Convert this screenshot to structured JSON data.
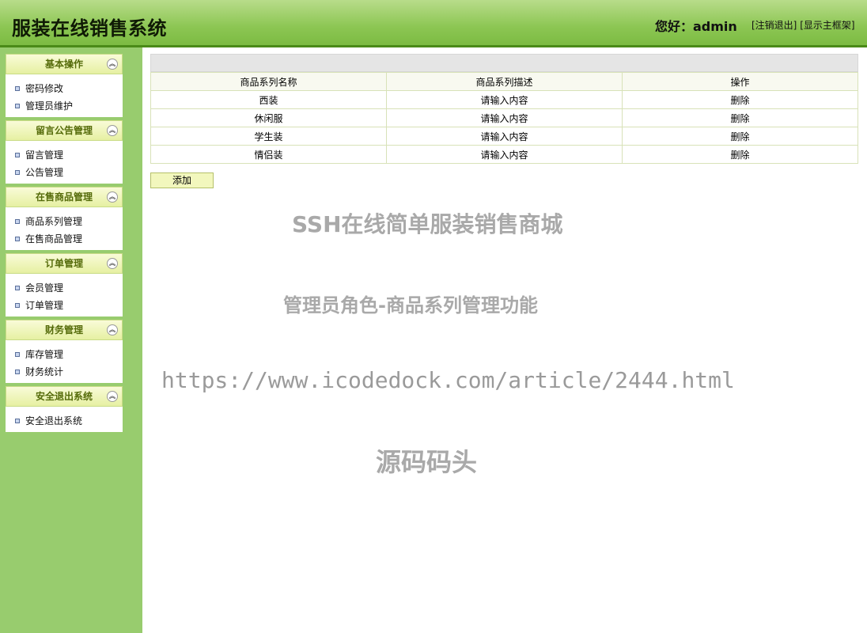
{
  "header": {
    "title": "服装在线销售系统",
    "greeting": "您好：admin",
    "logout_label": "[注销退出]",
    "main_frame_label": "[显示主框架]"
  },
  "sidebar": {
    "toggle_glyph": "︽",
    "groups": [
      {
        "title": "基本操作",
        "items": [
          "密码修改",
          "管理员维护"
        ]
      },
      {
        "title": "留言公告管理",
        "items": [
          "留言管理",
          "公告管理"
        ]
      },
      {
        "title": "在售商品管理",
        "items": [
          "商品系列管理",
          "在售商品管理"
        ]
      },
      {
        "title": "订单管理",
        "items": [
          "会员管理",
          "订单管理"
        ]
      },
      {
        "title": "财务管理",
        "items": [
          "库存管理",
          "财务统计"
        ]
      },
      {
        "title": "安全退出系统",
        "items": [
          "安全退出系统"
        ]
      }
    ]
  },
  "table": {
    "columns": [
      "商品系列名称",
      "商品系列描述",
      "操作"
    ],
    "rows": [
      {
        "name": "西装",
        "desc": "请输入内容",
        "op": "删除"
      },
      {
        "name": "休闲服",
        "desc": "请输入内容",
        "op": "删除"
      },
      {
        "name": "学生装",
        "desc": "请输入内容",
        "op": "删除"
      },
      {
        "name": "情侣装",
        "desc": "请输入内容",
        "op": "删除"
      }
    ]
  },
  "add_button_label": "添加",
  "watermarks": {
    "line1": "SSH在线简单服装销售商城",
    "line2": "管理员角色-商品系列管理功能",
    "line3": "https://www.icodedock.com/article/2444.html",
    "line4": "源码码头"
  }
}
